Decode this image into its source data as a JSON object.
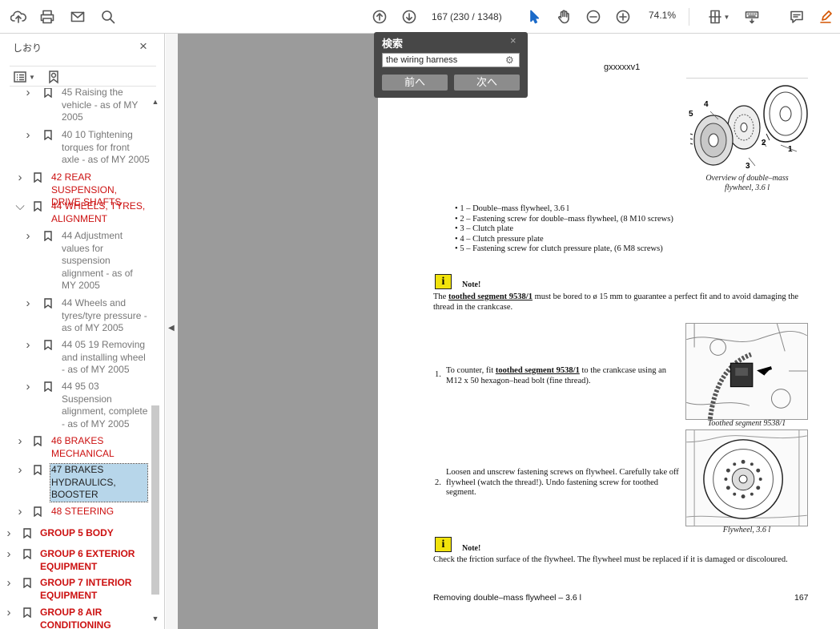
{
  "toolbar": {
    "page_current": "167",
    "page_total": "(230 / 1348)",
    "zoom": "74.1%"
  },
  "sidebar": {
    "title": "しおり",
    "close": "×",
    "items": [
      {
        "label_lines": [
          "45 Raising the",
          "vehicle - as of MY",
          "2005"
        ]
      },
      {
        "label_lines": [
          "40 10 Tightening",
          "torques for front",
          "axle - as of MY 2005"
        ]
      },
      {
        "label_lines": [
          "42 REAR SUSPENSION,",
          "DRIVE SHAFTS"
        ]
      },
      {
        "label_lines": [
          "44 WHEELS, TYRES,",
          "ALIGNMENT"
        ]
      },
      {
        "label_lines": [
          "44 Adjustment",
          "values for",
          "suspension",
          "alignment - as of",
          "MY 2005"
        ]
      },
      {
        "label_lines": [
          "44 Wheels and",
          "tyres/tyre pressure -",
          "as of MY 2005"
        ]
      },
      {
        "label_lines": [
          "44 05 19 Removing",
          "and installing wheel",
          "- as of MY 2005"
        ]
      },
      {
        "label_lines": [
          "44 95 03",
          "Suspension",
          "alignment, complete",
          "- as of MY 2005"
        ]
      },
      {
        "label_lines": [
          "46 BRAKES",
          "MECHANICAL"
        ]
      },
      {
        "label_lines": [
          "47 BRAKES",
          "HYDRAULICS,",
          "BOOSTER"
        ]
      },
      {
        "label_lines": [
          "48 STEERING"
        ]
      },
      {
        "label_lines": [
          "GROUP 5 BODY"
        ]
      },
      {
        "label_lines": [
          "GROUP 6 EXTERIOR",
          "EQUIPMENT"
        ]
      },
      {
        "label_lines": [
          "GROUP 7 INTERIOR",
          "EQUIPMENT"
        ]
      },
      {
        "label_lines": [
          "GROUP 8 AIR",
          "CONDITIONING"
        ]
      }
    ]
  },
  "find": {
    "title": "検索",
    "close": "×",
    "query": "the wiring harness",
    "prev": "前へ",
    "next": "次へ"
  },
  "document": {
    "header_code": "gxxxxxv1",
    "figure1": {
      "callouts": [
        "4",
        "5",
        "3",
        "2",
        "1"
      ],
      "caption_lines": [
        "Overview of double–mass",
        "flywheel, 3.6 l"
      ]
    },
    "legend": [
      "1 – Double–mass flywheel, 3.6 l",
      "2 – Fastening screw for double–mass flywheel, (8 M10 screws)",
      "3 – Clutch plate",
      "4 – Clutch pressure plate",
      "5 – Fastening screw for clutch pressure plate, (6 M8 screws)"
    ],
    "note_label": "Note!",
    "note1": {
      "pre": "The ",
      "link": "toothed segment 9538/1",
      "post": " must be bored to ø 15 mm to guarantee a perfect fit and to avoid damaging the",
      "line2": "thread in the crankcase."
    },
    "step1": {
      "number": "1.",
      "pre": "To counter, fit ",
      "link": "toothed segment 9538/1",
      "post": " to the crankcase using an",
      "line2": "M12 x 50 hexagon–head bolt (fine thread)."
    },
    "figure2_caption": "Toothed segment 9538/1",
    "step2": {
      "number": "2.",
      "lines": [
        "Loosen and unscrew fastening screws on flywheel. Carefully take off",
        "flywheel (watch the thread!). Undo fastening screw for toothed",
        "segment."
      ]
    },
    "figure3_caption": "Flywheel, 3.6 l",
    "note2_text": "Check the friction surface of the flywheel. The flywheel must be replaced if it is damaged or discoloured.",
    "footer_title": "Removing double–mass flywheel – 3.6 l",
    "footer_page": "167"
  }
}
